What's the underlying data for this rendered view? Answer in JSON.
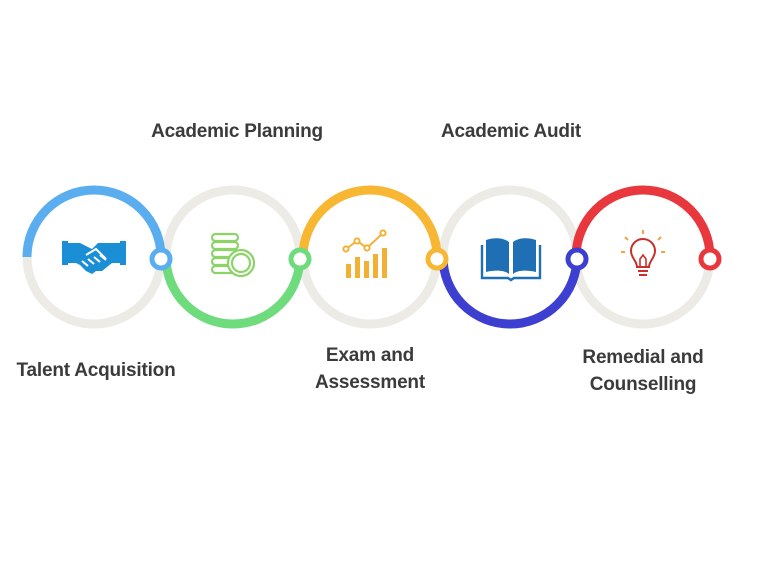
{
  "steps": [
    {
      "name": "talent-acquisition",
      "lines": [
        "Talent Acquisition"
      ],
      "icon": "handshake-icon",
      "color": "#5aaef0"
    },
    {
      "name": "academic-planning",
      "lines": [
        "Academic Planning"
      ],
      "icon": "coins-icon",
      "color": "#6edc7c"
    },
    {
      "name": "exam-and-assessment",
      "lines": [
        "Exam and",
        "Assessment"
      ],
      "icon": "bar-chart-icon",
      "color": "#f7b732"
    },
    {
      "name": "academic-audit",
      "lines": [
        "Academic Audit"
      ],
      "icon": "book-icon",
      "color": "#3c3fcf"
    },
    {
      "name": "remedial-and-counselling",
      "lines": [
        "Remedial and",
        "Counselling"
      ],
      "icon": "lightbulb-icon",
      "color": "#e8383d"
    }
  ],
  "colors": {
    "track": "#ecebe5",
    "text": "#3b3b3b",
    "icon_blue": "#1a8fd6",
    "icon_green": "#8cd46a",
    "icon_yellow": "#f2b134",
    "icon_navy": "#1f6fb5",
    "icon_red": "#c9302c"
  }
}
